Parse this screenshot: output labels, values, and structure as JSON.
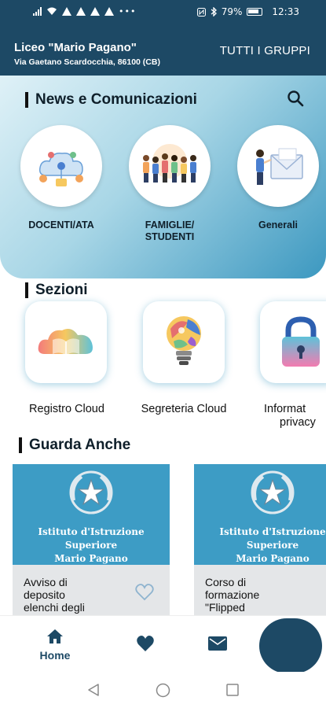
{
  "status_bar": {
    "battery": "79%",
    "time": "12:33"
  },
  "header": {
    "school_name": "Liceo \"Mario Pagano\"",
    "address": "Via Gaetano Scardocchia, 86100 (CB)",
    "groups_button": "TUTTI I GRUPPI"
  },
  "news": {
    "title": "News e Comunicazioni",
    "categories": [
      {
        "label": "DOCENTI/ATA",
        "icon": "cloud-network-icon"
      },
      {
        "label_line1": "FAMIGLIE/",
        "label_line2": "STUDENTI",
        "icon": "people-group-icon"
      },
      {
        "label": "Generali",
        "icon": "mail-person-icon"
      }
    ]
  },
  "sezioni": {
    "title": "Sezioni",
    "items": [
      {
        "label": "Registro Cloud",
        "icon": "book-cloud-icon"
      },
      {
        "label": "Segreteria Cloud",
        "icon": "lightbulb-icon"
      },
      {
        "label_line1": "Informat",
        "label_line2": "privacy",
        "icon": "padlock-icon"
      }
    ]
  },
  "guarda_anche": {
    "title": "Guarda Anche",
    "cards": [
      {
        "inst_line1": "Istituto d'Istruzione",
        "inst_line2": "Superiore",
        "inst_line3": "Mario Pagano",
        "text_line1": "Avviso di",
        "text_line2": "deposito",
        "text_line3": "elenchi degli"
      },
      {
        "inst_line1": "Istituto d'Istruzione",
        "inst_line2": "Superiore",
        "inst_line3": "Mario Pagano",
        "text_line1": "Corso di",
        "text_line2": "formazione",
        "text_line3": "\"Flipped"
      }
    ]
  },
  "bottom_nav": {
    "home_label": "Home"
  },
  "colors": {
    "primary": "#1d4965",
    "accent": "#3d9cc5"
  }
}
